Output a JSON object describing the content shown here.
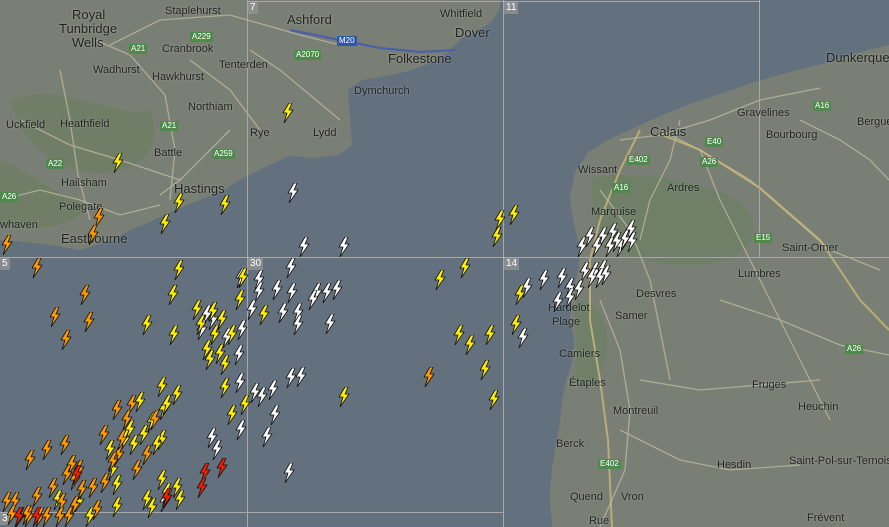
{
  "places": [
    {
      "id": "royal-tunbridge-wells-1",
      "name": "Royal"
    },
    {
      "id": "royal-tunbridge-wells-2",
      "name": "Tunbridge"
    },
    {
      "id": "royal-tunbridge-wells-3",
      "name": "Wells"
    },
    {
      "id": "staplehurst",
      "name": "Staplehurst"
    },
    {
      "id": "cranbrook",
      "name": "Cranbrook"
    },
    {
      "id": "wadhurst",
      "name": "Wadhurst"
    },
    {
      "id": "hawkhurst",
      "name": "Hawkhurst"
    },
    {
      "id": "tenterden",
      "name": "Tenterden"
    },
    {
      "id": "northiam",
      "name": "Northiam"
    },
    {
      "id": "uckfield",
      "name": "Uckfield"
    },
    {
      "id": "heathfield",
      "name": "Heathfield"
    },
    {
      "id": "battle",
      "name": "Battle"
    },
    {
      "id": "hailsham",
      "name": "Hailsham"
    },
    {
      "id": "hastings",
      "name": "Hastings"
    },
    {
      "id": "polegate",
      "name": "Polegate"
    },
    {
      "id": "newhaven",
      "name": "whaven"
    },
    {
      "id": "eastbourne",
      "name": "Eastbourne"
    },
    {
      "id": "ashford",
      "name": "Ashford"
    },
    {
      "id": "whitfield",
      "name": "Whitfield"
    },
    {
      "id": "dover",
      "name": "Dover"
    },
    {
      "id": "folkestone",
      "name": "Folkestone"
    },
    {
      "id": "dymchurch",
      "name": "Dymchurch"
    },
    {
      "id": "rye",
      "name": "Rye"
    },
    {
      "id": "lydd",
      "name": "Lydd"
    },
    {
      "id": "dunkerque",
      "name": "Dunkerque"
    },
    {
      "id": "gravelines",
      "name": "Gravelines"
    },
    {
      "id": "calais",
      "name": "Calais"
    },
    {
      "id": "bourbourg",
      "name": "Bourbourg"
    },
    {
      "id": "bergues",
      "name": "Bergue"
    },
    {
      "id": "wissant",
      "name": "Wissant"
    },
    {
      "id": "ardres",
      "name": "Ardres"
    },
    {
      "id": "marquise",
      "name": "Marquise"
    },
    {
      "id": "saint-omer",
      "name": "Saint-Omer"
    },
    {
      "id": "lumbres",
      "name": "Lumbres"
    },
    {
      "id": "desvres",
      "name": "Desvres"
    },
    {
      "id": "hardelot-1",
      "name": "Hardelot"
    },
    {
      "id": "hardelot-2",
      "name": "Plage"
    },
    {
      "id": "samer",
      "name": "Samer"
    },
    {
      "id": "camiers",
      "name": "Camiers"
    },
    {
      "id": "etaples",
      "name": "Étaples"
    },
    {
      "id": "fruges",
      "name": "Fruges"
    },
    {
      "id": "montreuil",
      "name": "Montreuil"
    },
    {
      "id": "heuchin",
      "name": "Heuchin"
    },
    {
      "id": "berck",
      "name": "Berck"
    },
    {
      "id": "hesdin",
      "name": "Hesdin"
    },
    {
      "id": "saint-pol",
      "name": "Saint-Pol-sur-Ternois"
    },
    {
      "id": "quend",
      "name": "Quend"
    },
    {
      "id": "vron",
      "name": "Vron"
    },
    {
      "id": "rue",
      "name": "Rue"
    },
    {
      "id": "frevent",
      "name": "Frévent"
    }
  ],
  "roads": [
    {
      "id": "a21-north",
      "label": "A21"
    },
    {
      "id": "a229",
      "label": "A229"
    },
    {
      "id": "a21-south",
      "label": "A21"
    },
    {
      "id": "a22",
      "label": "A22"
    },
    {
      "id": "a259",
      "label": "A259"
    },
    {
      "id": "a26-uk",
      "label": "A26"
    },
    {
      "id": "a2070",
      "label": "A2070"
    },
    {
      "id": "m20",
      "label": "M20"
    },
    {
      "id": "a16-north",
      "label": "A16"
    },
    {
      "id": "e40",
      "label": "E40"
    },
    {
      "id": "e402-north",
      "label": "E402"
    },
    {
      "id": "a26-calais",
      "label": "A26"
    },
    {
      "id": "a16-south",
      "label": "A16"
    },
    {
      "id": "e15",
      "label": "E15"
    },
    {
      "id": "a26-south",
      "label": "A26"
    },
    {
      "id": "e402-south",
      "label": "E402"
    }
  ],
  "grid_cells": [
    {
      "id": "cell-7",
      "label": "7"
    },
    {
      "id": "cell-11",
      "label": "11"
    },
    {
      "id": "cell-5",
      "label": "5"
    },
    {
      "id": "cell-30",
      "label": "30"
    },
    {
      "id": "cell-14",
      "label": "14"
    },
    {
      "id": "cell-3",
      "label": "3"
    }
  ],
  "strike_colors": {
    "newest": "#ffffff",
    "recent": "#ffee00",
    "older": "#ff9a00",
    "oldest": "#ee1f00"
  },
  "lightning_strikes": {
    "count": 176,
    "by_age": {
      "newest": 62,
      "recent": 63,
      "older": 44,
      "oldest": 7
    }
  }
}
